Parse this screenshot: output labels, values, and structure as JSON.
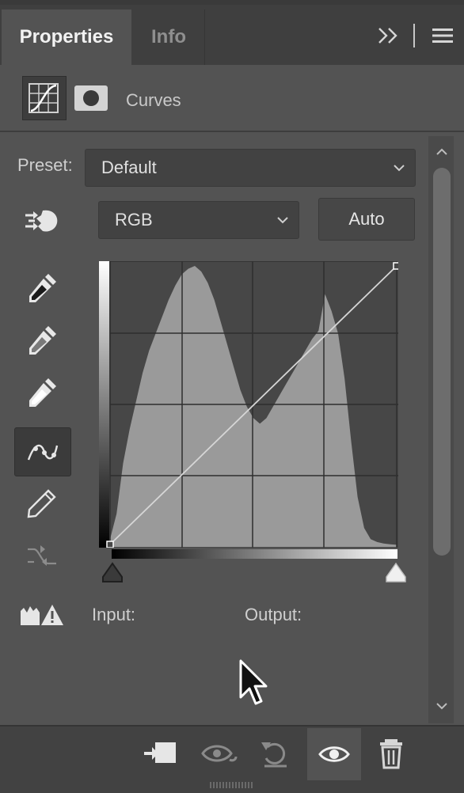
{
  "tabs": [
    {
      "label": "Properties",
      "active": true
    },
    {
      "label": "Info",
      "active": false
    }
  ],
  "adjustment": {
    "label": "Curves"
  },
  "preset": {
    "label": "Preset:",
    "value": "Default"
  },
  "channel": {
    "value": "RGB"
  },
  "auto_label": "Auto",
  "readout": {
    "input_label": "Input:",
    "output_label": "Output:"
  },
  "curve": {
    "points": [
      [
        0,
        0
      ],
      [
        255,
        255
      ]
    ],
    "input_range": [
      0,
      255
    ],
    "output_range": [
      0,
      255
    ]
  },
  "histogram": [
    0.03,
    0.12,
    0.3,
    0.42,
    0.52,
    0.62,
    0.7,
    0.76,
    0.82,
    0.88,
    0.93,
    0.97,
    0.99,
    1.0,
    0.98,
    0.94,
    0.88,
    0.8,
    0.72,
    0.64,
    0.56,
    0.5,
    0.46,
    0.44,
    0.46,
    0.5,
    0.54,
    0.58,
    0.62,
    0.66,
    0.7,
    0.74,
    0.77,
    0.9,
    0.84,
    0.76,
    0.6,
    0.38,
    0.18,
    0.07,
    0.03,
    0.02,
    0.015,
    0.012,
    0.01
  ],
  "colors": {
    "panel": "#535353",
    "histogram": "#9a9a9a",
    "graph_bg": "#474747",
    "curve": "#d6d6d6"
  },
  "icons": [
    "expand-panels-icon",
    "panel-menu-icon",
    "curves-adjustment-icon",
    "layer-mask-icon",
    "on-image-adjust-icon",
    "sample-black-eyedropper-icon",
    "sample-gray-eyedropper-icon",
    "sample-white-eyedropper-icon",
    "edit-points-curve-icon",
    "draw-pencil-icon",
    "smooth-curve-icon",
    "clipping-warning-icon",
    "clip-to-layer-icon",
    "view-previous-state-icon",
    "reset-icon",
    "visibility-eye-icon",
    "delete-icon"
  ]
}
